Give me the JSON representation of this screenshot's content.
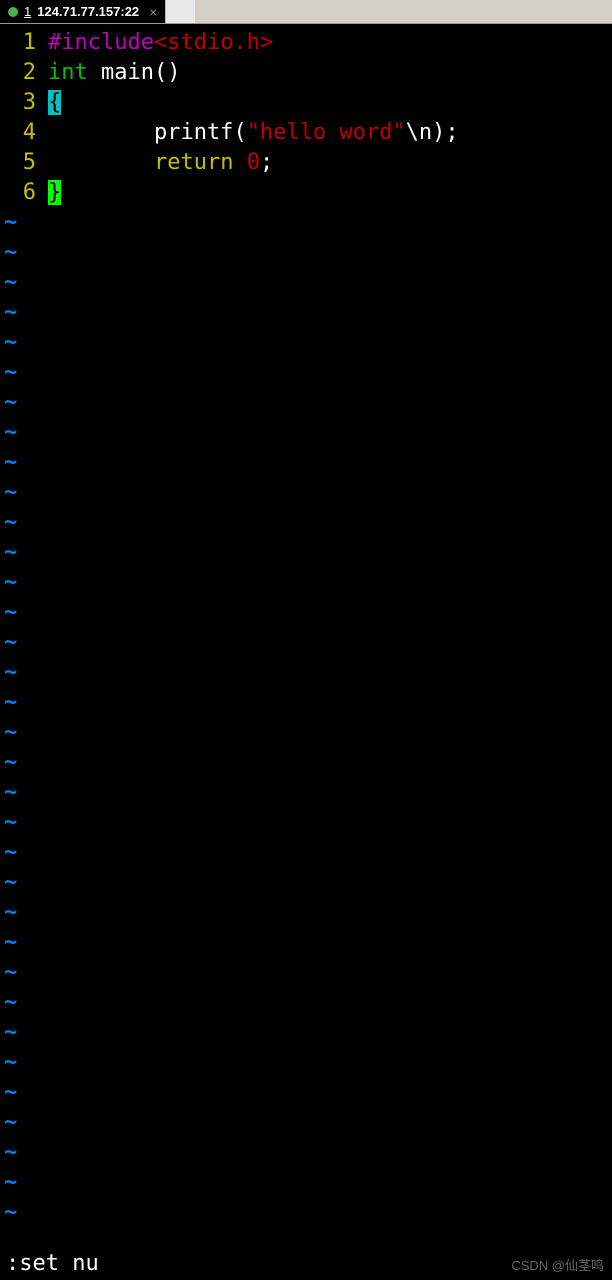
{
  "tabs": {
    "active": {
      "number": "1",
      "title": "124.71.77.157:22",
      "close": "×"
    }
  },
  "code": {
    "lines": [
      {
        "num": "1",
        "tokens": [
          {
            "cls": "c-preproc",
            "t": "#include"
          },
          {
            "cls": "c-angle",
            "t": "<stdio.h>"
          }
        ]
      },
      {
        "num": "2",
        "tokens": [
          {
            "cls": "c-type",
            "t": "int"
          },
          {
            "cls": "c-ident",
            "t": " main"
          },
          {
            "cls": "c-punct",
            "t": "()"
          }
        ]
      },
      {
        "num": "3",
        "tokens": [
          {
            "cls": "c-brace-open",
            "t": "{"
          }
        ]
      },
      {
        "num": "4",
        "tokens": [
          {
            "cls": "c-ident",
            "t": "        printf"
          },
          {
            "cls": "c-punct",
            "t": "("
          },
          {
            "cls": "c-string",
            "t": "\"hello word\""
          },
          {
            "cls": "c-punct",
            "t": "\\n);"
          }
        ]
      },
      {
        "num": "5",
        "tokens": [
          {
            "cls": "c-ident",
            "t": "        "
          },
          {
            "cls": "c-keyword",
            "t": "return"
          },
          {
            "cls": "c-ident",
            "t": " "
          },
          {
            "cls": "c-number",
            "t": "0"
          },
          {
            "cls": "c-punct",
            "t": ";"
          }
        ]
      },
      {
        "num": "6",
        "tokens": [
          {
            "cls": "c-brace-close",
            "t": "}"
          }
        ]
      }
    ],
    "tilde": "~",
    "tilde_count": 34
  },
  "command_line": ":set nu",
  "watermark": "CSDN @仙茎鸣"
}
